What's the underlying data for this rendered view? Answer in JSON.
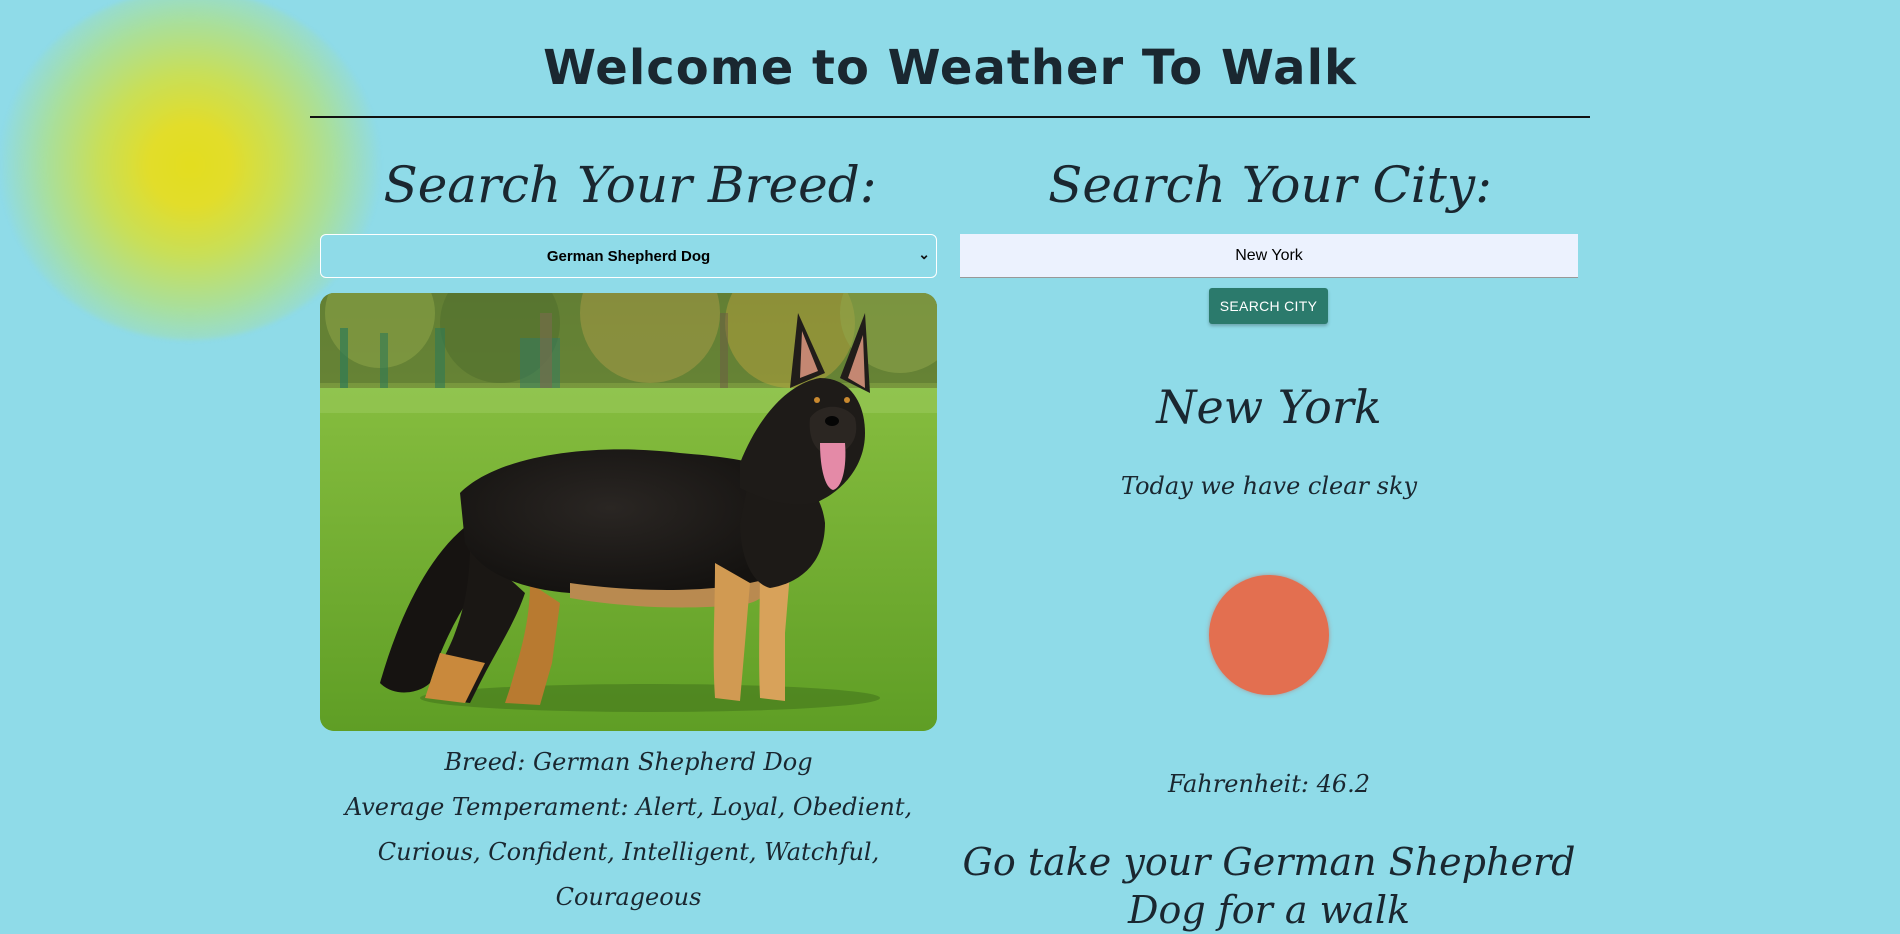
{
  "header": {
    "title": "Welcome to Weather To Walk"
  },
  "breed_panel": {
    "heading": "Search Your Breed:",
    "selected_breed": "German Shepherd Dog",
    "breed_line": "Breed: German Shepherd Dog",
    "temperament_line": "Average Temperament: Alert, Loyal, Obedient, Curious, Confident, Intelligent, Watchful, Courageous"
  },
  "city_panel": {
    "heading": "Search Your City:",
    "city_input_value": "New York",
    "search_button_label": "SEARCH CITY",
    "city_name": "New York",
    "weather_description": "Today we have clear sky",
    "weather_icon": "clear-sky-sun-icon",
    "temperature_text": "Fahrenheit: 46.2",
    "recommendation": "Go take your German Shepherd Dog for a walk"
  },
  "colors": {
    "background": "#8fdbe8",
    "button": "#2b7a6c",
    "weather_icon": "#e36f50",
    "sun_glow": "#e3dd1f"
  }
}
